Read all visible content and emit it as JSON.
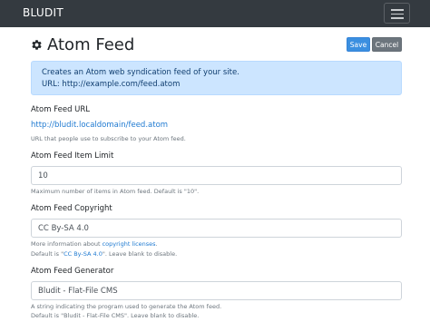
{
  "navbar": {
    "brand": "BLUDIT"
  },
  "page": {
    "title": "Atom Feed"
  },
  "buttons": {
    "save": "Save",
    "cancel": "Cancel"
  },
  "alert": {
    "line1": "Creates an Atom web syndication feed of your site.",
    "line2": "URL: http://example.com/feed.atom"
  },
  "fields": {
    "url": {
      "label": "Atom Feed URL",
      "value": "http://bludit.localdomain/feed.atom",
      "help": "URL that people use to subscribe to your Atom feed."
    },
    "limit": {
      "label": "Atom Feed Item Limit",
      "value": "10",
      "help": "Maximum number of items in Atom feed. Default is \"10\"."
    },
    "copyright": {
      "label": "Atom Feed Copyright",
      "value": "CC By-SA 4.0",
      "help_prefix": "More information about ",
      "help_link": "copyright licenses",
      "help_suffix": ".",
      "default_prefix": "Default is \"",
      "default_link": "CC By-SA 4.0",
      "default_suffix": "\". Leave blank to disable."
    },
    "generator": {
      "label": "Atom Feed Generator",
      "value": "Bludit - Flat-File CMS",
      "help": "A string indicating the program used to generate the Atom feed.",
      "help2": "Default is \"Bludit - Flat-File CMS\". Leave blank to disable."
    }
  }
}
